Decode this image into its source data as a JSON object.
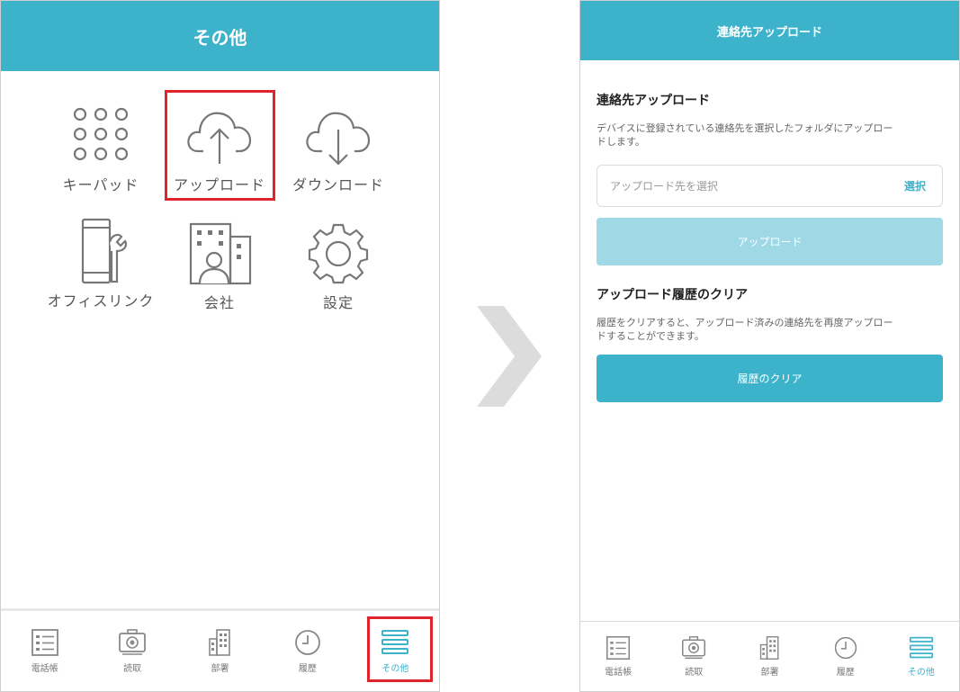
{
  "left": {
    "header_title": "その他",
    "menu": [
      {
        "label": "キーパッド",
        "icon": "keypad-icon"
      },
      {
        "label": "アップロード",
        "icon": "cloud-upload-icon"
      },
      {
        "label": "ダウンロード",
        "icon": "cloud-download-icon"
      },
      {
        "label": "オフィスリンク",
        "icon": "phone-wrench-icon"
      },
      {
        "label": "会社",
        "icon": "building-person-icon"
      },
      {
        "label": "設定",
        "icon": "gear-icon"
      }
    ],
    "tabs": [
      {
        "label": "電話帳",
        "icon": "phonebook-icon"
      },
      {
        "label": "読取",
        "icon": "camera-icon"
      },
      {
        "label": "部署",
        "icon": "building-icon"
      },
      {
        "label": "履歴",
        "icon": "clock-icon"
      },
      {
        "label": "その他",
        "icon": "menu-icon"
      }
    ]
  },
  "right": {
    "header_title": "連絡先アップロード",
    "upload_section": {
      "title": "連絡先アップロード",
      "desc1": "デバイスに登録されている連絡先を選択したフォルダにアップロー",
      "desc2": "ドします。",
      "input_placeholder": "アップロード先を選択",
      "select_label": "選択",
      "upload_button": "アップロード"
    },
    "clear_section": {
      "title": "アップロード履歴のクリア",
      "desc1": "履歴をクリアすると、アップロード済みの連絡先を再度アップロー",
      "desc2": "ドすることができます。",
      "clear_button": "履歴のクリア"
    },
    "tabs": [
      {
        "label": "電話帳",
        "icon": "phonebook-icon"
      },
      {
        "label": "読取",
        "icon": "camera-icon"
      },
      {
        "label": "部署",
        "icon": "building-icon"
      },
      {
        "label": "履歴",
        "icon": "clock-icon"
      },
      {
        "label": "その他",
        "icon": "menu-icon"
      }
    ]
  },
  "colors": {
    "accent": "#3cb2cb",
    "accent_disabled": "#9fd9e5",
    "highlight": "#e0242b",
    "arrow": "#dcdcdc"
  }
}
